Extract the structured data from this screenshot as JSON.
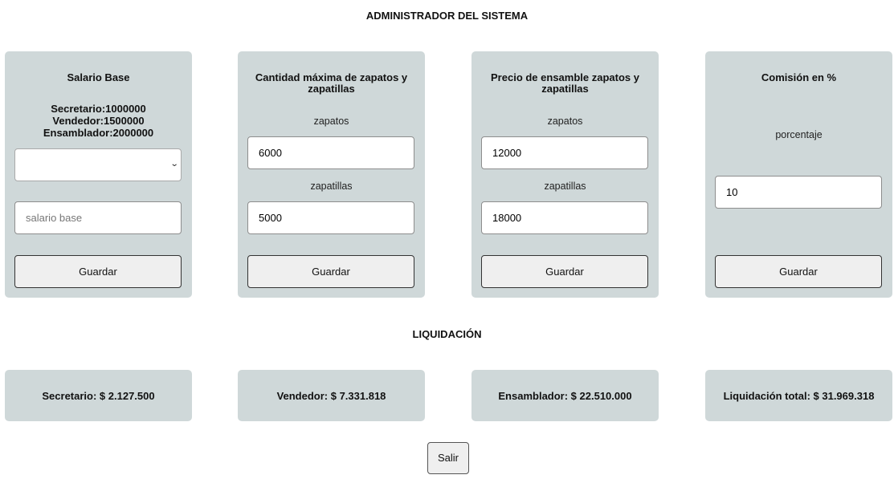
{
  "header": {
    "title": "ADMINISTRADOR DEL SISTEMA"
  },
  "cards": {
    "salary": {
      "title": "Salario Base",
      "info": [
        "Secretario:1000000",
        "Vendedor:1500000",
        "Ensamblador:2000000"
      ],
      "select_value": "",
      "input_placeholder": "salario base",
      "button_label": "Guardar"
    },
    "max_quantity": {
      "title": "Cantidad máxima de zapatos y zapatillas",
      "label_shoes": "zapatos",
      "value_shoes": "6000",
      "label_sneakers": "zapatillas",
      "value_sneakers": "5000",
      "button_label": "Guardar"
    },
    "assembly_price": {
      "title": "Precio de ensamble zapatos y zapatillas",
      "label_shoes": "zapatos",
      "value_shoes": "12000",
      "label_sneakers": "zapatillas",
      "value_sneakers": "18000",
      "button_label": "Guardar"
    },
    "commission": {
      "title": "Comisión en %",
      "label": "porcentaje",
      "value": "10",
      "button_label": "Guardar"
    }
  },
  "liquidation": {
    "title": "LIQUIDACIÓN",
    "secretary": "Secretario: $ 2.127.500",
    "seller": "Vendedor: $ 7.331.818",
    "assembler": "Ensamblador: $ 22.510.000",
    "total": "Liquidación total: $ 31.969.318"
  },
  "footer": {
    "exit_label": "Salir"
  },
  "icons": {
    "select_arrow": "chevron-down-icon"
  },
  "colors": {
    "card_background": "#cfd8d9",
    "button_background": "#efefef"
  }
}
